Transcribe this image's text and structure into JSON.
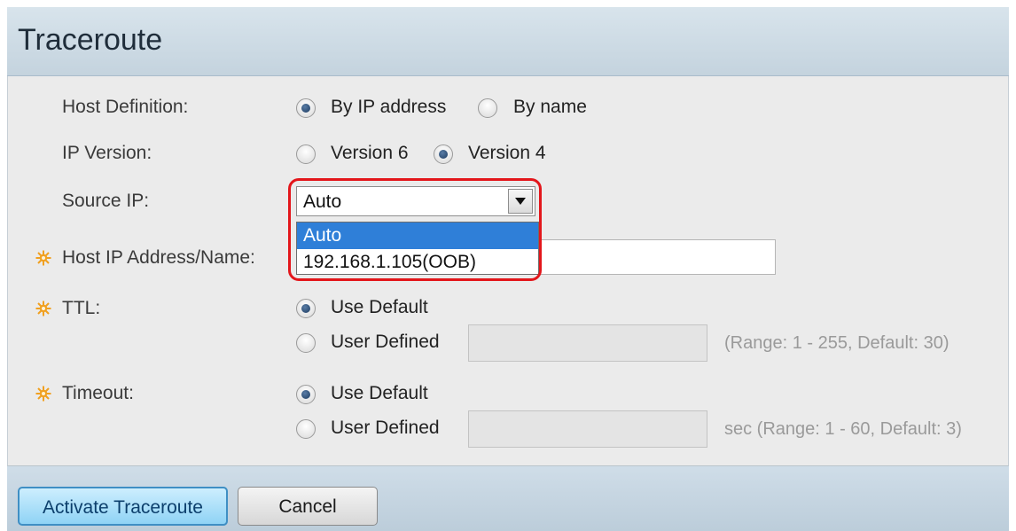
{
  "page": {
    "title": "Traceroute"
  },
  "form": {
    "host_definition": {
      "label": "Host Definition:",
      "options": [
        "By IP address",
        "By name"
      ],
      "selected": "By IP address"
    },
    "ip_version": {
      "label": "IP Version:",
      "options": [
        "Version 6",
        "Version 4"
      ],
      "selected": "Version 4"
    },
    "source_ip": {
      "label": "Source IP:",
      "value": "Auto",
      "dropdown_options": [
        "Auto",
        "192.168.1.105(OOB)"
      ],
      "highlighted_option": "Auto"
    },
    "host_address": {
      "label": "Host IP Address/Name:",
      "value": ""
    },
    "ttl": {
      "label": "TTL:",
      "options": [
        "Use Default",
        "User Defined"
      ],
      "selected": "Use Default",
      "user_value": "",
      "hint": "(Range: 1 - 255, Default: 30)"
    },
    "timeout": {
      "label": "Timeout:",
      "options": [
        "Use Default",
        "User Defined"
      ],
      "selected": "Use Default",
      "user_value": "",
      "hint": "sec (Range: 1 - 60, Default: 3)"
    }
  },
  "buttons": {
    "activate": "Activate Traceroute",
    "cancel": "Cancel"
  },
  "colors": {
    "required_icon": "#f0a020",
    "highlight_ring": "#e3161b",
    "dropdown_selected": "#2f7fd8"
  },
  "icons": {
    "required": "required-star-icon",
    "select_arrow": "chevron-down-icon"
  }
}
